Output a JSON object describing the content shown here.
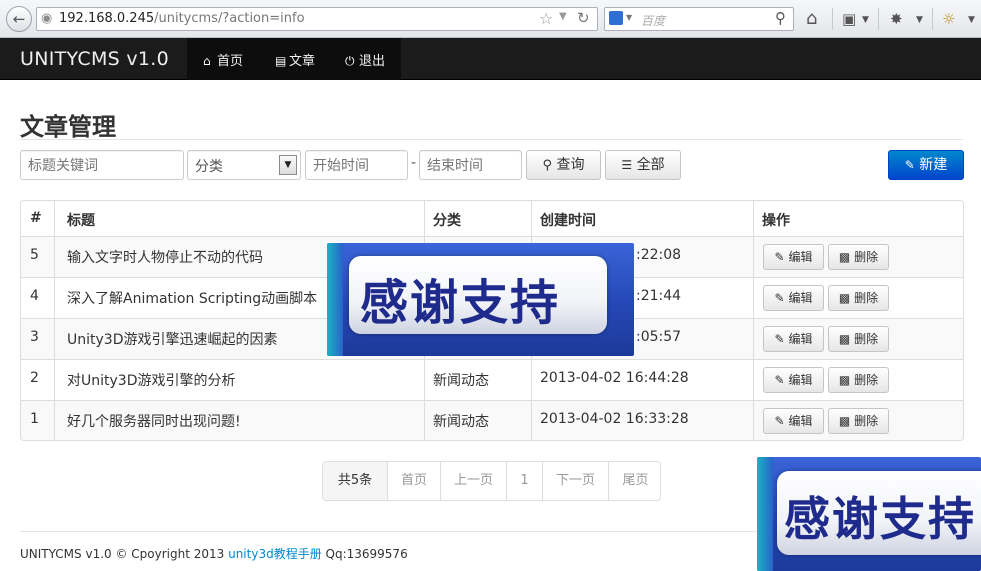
{
  "browser": {
    "url_host": "192.168.0.245",
    "url_path": "/unitycms/?action=info",
    "search_placeholder": "百度"
  },
  "navbar": {
    "brand": "UNITYCMS v1.0",
    "items": [
      {
        "label": "首页",
        "icon": "home-icon"
      },
      {
        "label": "文章",
        "icon": "list-icon"
      },
      {
        "label": "退出",
        "icon": "power-icon"
      }
    ]
  },
  "page": {
    "title": "文章管理"
  },
  "filters": {
    "keyword_placeholder": "标题关键词",
    "category_value": "分类",
    "start_placeholder": "开始时间",
    "separator": "-",
    "end_placeholder": "结束时间",
    "search_label": "查询",
    "all_label": "全部",
    "new_label": "新建"
  },
  "table": {
    "headers": [
      "#",
      "标题",
      "分类",
      "创建时间",
      "操作"
    ],
    "rows": [
      {
        "id": "5",
        "title": "输入文字时人物停止不动的代码",
        "category": "",
        "created": ":22:08"
      },
      {
        "id": "4",
        "title": "深入了解Animation Scripting动画脚本",
        "category": "",
        "created": ":21:44"
      },
      {
        "id": "3",
        "title": "Unity3D游戏引擎迅速崛起的因素",
        "category": "",
        "created": ":05:57"
      },
      {
        "id": "2",
        "title": "对Unity3D游戏引擎的分析",
        "category": "新闻动态",
        "created": "2013-04-02 16:44:28"
      },
      {
        "id": "1",
        "title": "好几个服务器同时出现问题!",
        "category": "新闻动态",
        "created": "2013-04-02 16:33:28"
      }
    ],
    "edit_label": "编辑",
    "delete_label": "删除"
  },
  "pagination": {
    "total": "共5条",
    "first": "首页",
    "prev": "上一页",
    "current": "1",
    "next": "下一页",
    "last": "尾页"
  },
  "footer": {
    "text_before": "UNITYCMS v1.0 © Cpoyright 2013 ",
    "link": "unity3d教程手册",
    "text_after": " Qq:13699576"
  },
  "overlay": {
    "banner_text": "感谢支持"
  },
  "colors": {
    "navbar_bg": "#1b1b1b",
    "primary": "#0066cc",
    "link": "#0088cc",
    "banner": "#2547b5"
  }
}
